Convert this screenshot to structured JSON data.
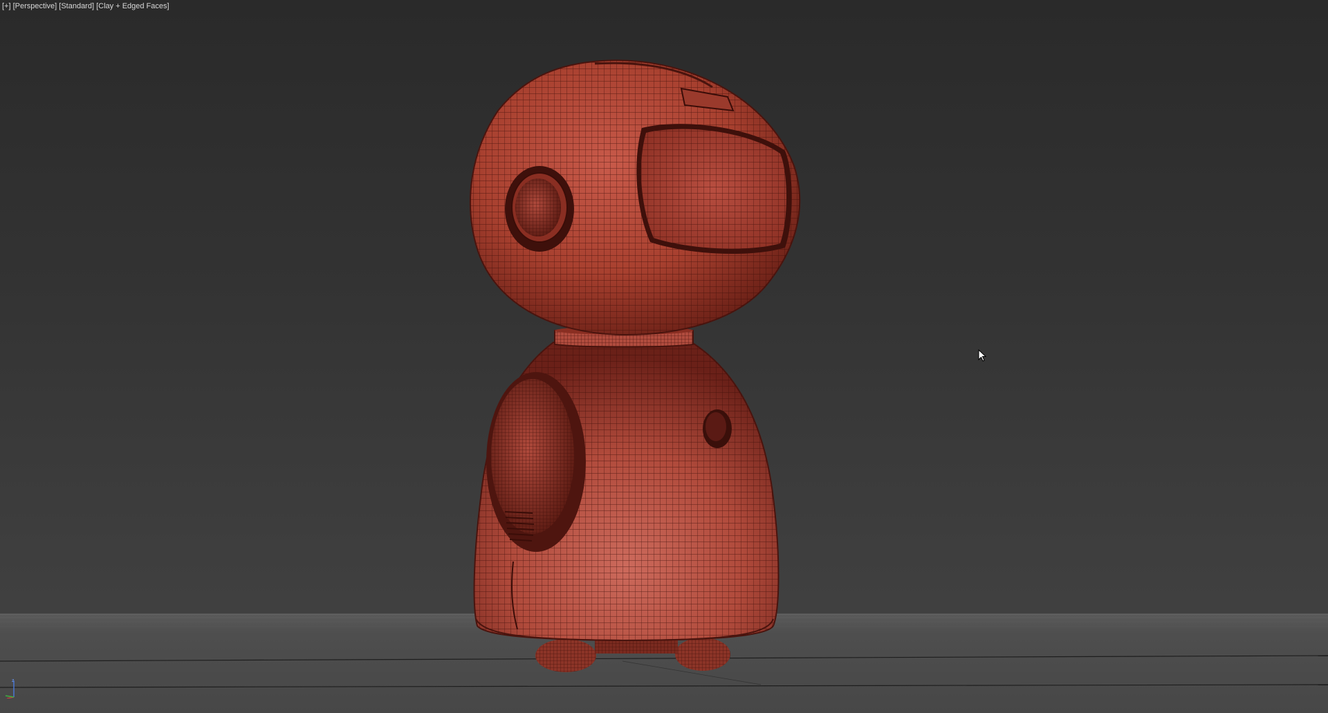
{
  "viewport": {
    "label_plus": "[+]",
    "label_view": "[Perspective]",
    "label_shading": "[Standard]",
    "label_mode": "[Clay + Edged Faces]"
  },
  "scene": {
    "model_color": "#b5483a",
    "model_dark": "#5a1a14",
    "ground_color": "#4a4a4a",
    "wire_color": "#3a0d08"
  },
  "gizmo": {
    "z_label": "z"
  }
}
